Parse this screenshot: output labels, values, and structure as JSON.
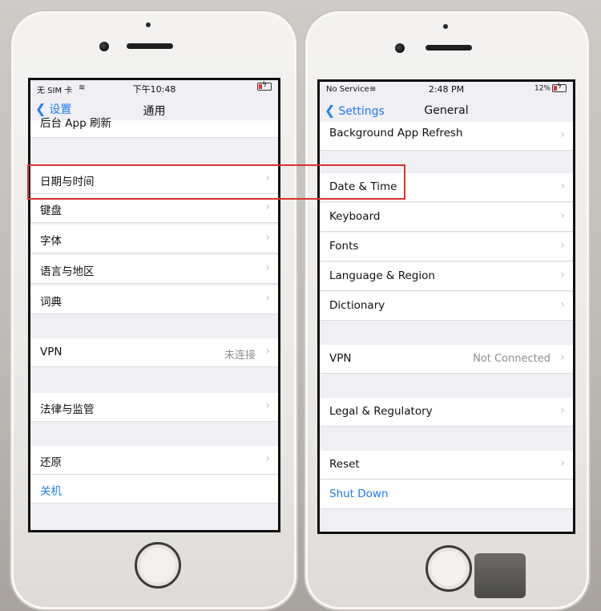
{
  "left_phone": {
    "status": {
      "carrier": "无 SIM 卡",
      "time": "下午10:48"
    },
    "nav": {
      "back_label": "设置",
      "title": "通用"
    },
    "rows": {
      "background_refresh": "后台 App 刷新",
      "date_time": "日期与时间",
      "keyboard": "键盘",
      "fonts": "字体",
      "language_region": "语言与地区",
      "dictionary": "词典",
      "vpn": "VPN",
      "vpn_status": "未连接",
      "legal": "法律与监管",
      "reset": "还原",
      "shutdown": "关机"
    }
  },
  "right_phone": {
    "status": {
      "carrier": "No Service",
      "time": "2:48 PM",
      "battery": "12%"
    },
    "nav": {
      "back_label": "Settings",
      "title": "General"
    },
    "rows": {
      "background_refresh": "Background App Refresh",
      "date_time": "Date & Time",
      "keyboard": "Keyboard",
      "fonts": "Fonts",
      "language_region": "Language & Region",
      "dictionary": "Dictionary",
      "vpn": "VPN",
      "vpn_status": "Not Connected",
      "legal": "Legal & Regulatory",
      "reset": "Reset",
      "shutdown": "Shut Down"
    }
  },
  "colors": {
    "accent": "#1f7cf5",
    "highlight": "#d8332b"
  }
}
